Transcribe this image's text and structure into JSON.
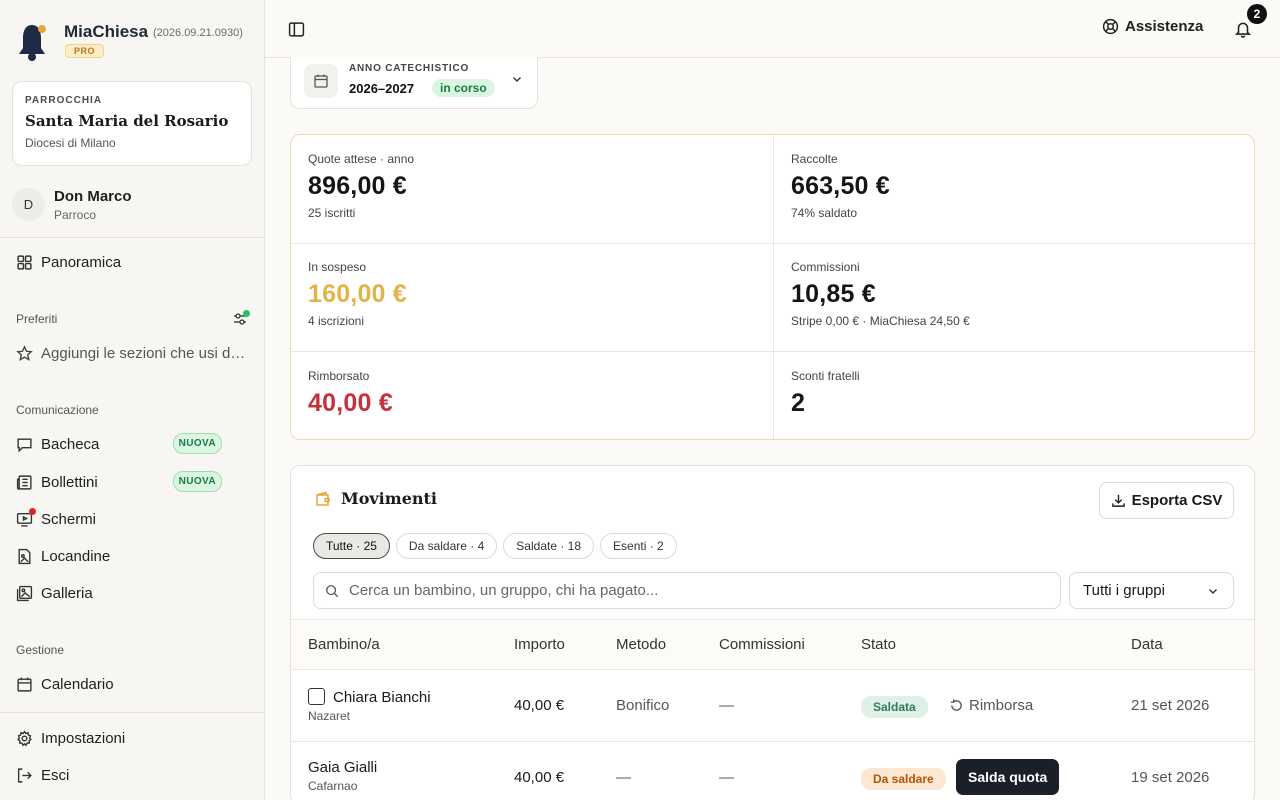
{
  "brand": {
    "name": "MiaChiesa",
    "version": "(2026.09.21.0930)",
    "plan": "PRO"
  },
  "parish": {
    "label": "PARROCCHIA",
    "name": "Santa Maria del Rosario",
    "diocese": "Diocesi di Milano"
  },
  "user": {
    "initial": "D",
    "name": "Don Marco",
    "role": "Parroco"
  },
  "nav": {
    "overview": "Panoramica",
    "favorites_label": "Preferiti",
    "favorites_hint": "Aggiungi le sezioni che usi di più",
    "communication_label": "Comunicazione",
    "communication": [
      {
        "label": "Bacheca",
        "badge": "NUOVA",
        "icon": "message-icon"
      },
      {
        "label": "Bollettini",
        "badge": "NUOVA",
        "icon": "newspaper-icon"
      },
      {
        "label": "Schermi",
        "badge": "",
        "icon": "screen-icon"
      },
      {
        "label": "Locandine",
        "badge": "",
        "icon": "file-image-icon"
      },
      {
        "label": "Galleria",
        "badge": "",
        "icon": "gallery-icon"
      }
    ],
    "management_label": "Gestione",
    "calendar": "Calendario",
    "settings": "Impostazioni",
    "logout": "Esci"
  },
  "topbar": {
    "help": "Assistenza",
    "notifications": "2"
  },
  "year": {
    "label": "ANNO CATECHISTICO",
    "value": "2026–2027",
    "status": "in corso"
  },
  "stats": [
    {
      "label": "Quote attese · anno",
      "value": "896,00 €",
      "sub": "25 iscritti",
      "color": "#151515"
    },
    {
      "label": "Raccolte",
      "value": "663,50 €",
      "sub": "74% saldato",
      "color": "#151515"
    },
    {
      "label": "In sospeso",
      "value": "160,00 €",
      "sub": "4 iscrizioni",
      "color": "#e3b34a"
    },
    {
      "label": "Commissioni",
      "value": "10,85 €",
      "sub": "Stripe 0,00 € · MiaChiesa 24,50 €",
      "color": "#151515"
    },
    {
      "label": "Rimborsato",
      "value": "40,00 €",
      "sub": "",
      "color": "#c8303c"
    },
    {
      "label": "Sconti fratelli",
      "value": "2",
      "sub": "",
      "color": "#151515"
    }
  ],
  "movements": {
    "title": "Movimenti",
    "export": "Esporta CSV",
    "filters": [
      "Tutte · 25",
      "Da saldare · 4",
      "Saldate · 18",
      "Esenti · 2"
    ],
    "search_placeholder": "Cerca un bambino, un gruppo, chi ha pagato...",
    "group_select": "Tutti i gruppi",
    "columns": [
      "Bambino/a",
      "Importo",
      "Metodo",
      "Commissioni",
      "Stato",
      "Data"
    ],
    "rows": [
      {
        "child": "Chiara Bianchi",
        "group": "Nazaret",
        "amount": "40,00 €",
        "method": "Bonifico",
        "fees": "—",
        "status": "Saldata",
        "action": "Rimborsa",
        "date": "21 set 2026"
      },
      {
        "child": "Gaia Gialli",
        "group": "Cafarnao",
        "amount": "40,00 €",
        "method": "—",
        "fees": "—",
        "status": "Da saldare",
        "action": "Salda quota",
        "date": "19 set 2026"
      }
    ]
  }
}
